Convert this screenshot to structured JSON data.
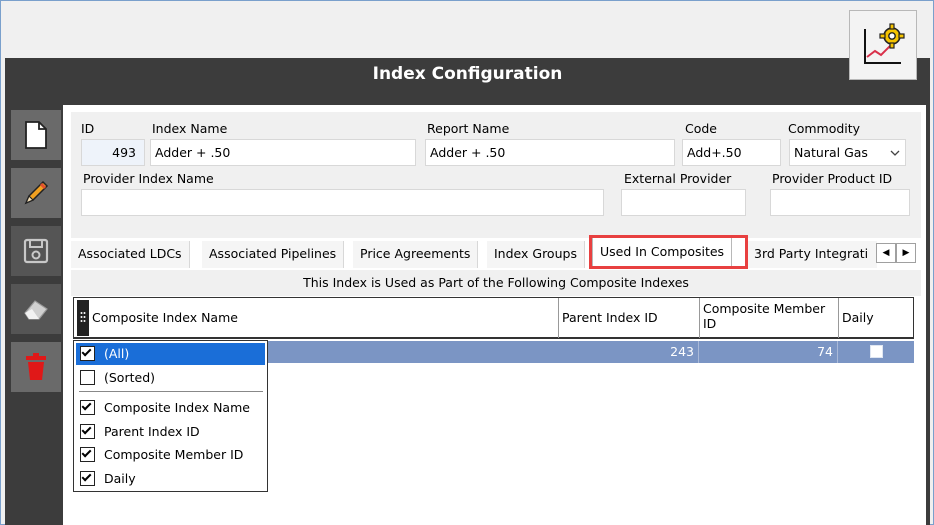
{
  "window": {
    "title": "Index Configuration"
  },
  "toolbar": {
    "buttons": [
      {
        "name": "new-document",
        "icon": "document-icon"
      },
      {
        "name": "edit",
        "icon": "pencil-icon"
      },
      {
        "name": "save",
        "icon": "floppy-disk-icon"
      },
      {
        "name": "clear",
        "icon": "eraser-icon"
      },
      {
        "name": "delete",
        "icon": "trash-icon"
      }
    ]
  },
  "form": {
    "id_label": "ID",
    "id_value": "493",
    "index_name_label": "Index Name",
    "index_name_value": "Adder + .50",
    "report_name_label": "Report Name",
    "report_name_value": "Adder + .50",
    "code_label": "Code",
    "code_value": "Add+.50",
    "commodity_label": "Commodity",
    "commodity_value": "Natural Gas",
    "provider_index_name_label": "Provider Index Name",
    "provider_index_name_value": "",
    "external_provider_label": "External Provider",
    "external_provider_value": "",
    "provider_product_id_label": "Provider Product ID",
    "provider_product_id_value": ""
  },
  "tabs": [
    {
      "label": "Associated LDCs"
    },
    {
      "label": "Associated Pipelines"
    },
    {
      "label": "Price Agreements"
    },
    {
      "label": "Index Groups"
    },
    {
      "label": "Used In Composites"
    },
    {
      "label": "3rd Party Integrati"
    }
  ],
  "grid": {
    "subtitle": "This Index is Used as Part of the Following Composite Indexes",
    "columns": [
      "Composite Index Name",
      "Parent Index ID",
      "Composite Member ID",
      "Daily"
    ],
    "rows": [
      {
        "parent_index_id": "243",
        "composite_member_id": "74",
        "daily": false
      }
    ]
  },
  "column_chooser": {
    "items": [
      {
        "label": "(All)",
        "checked": true,
        "selected": true
      },
      {
        "label": "(Sorted)",
        "checked": false,
        "selected": false
      },
      {
        "label": "Composite Index Name",
        "checked": true
      },
      {
        "label": "Parent Index ID",
        "checked": true
      },
      {
        "label": "Composite Member ID",
        "checked": true
      },
      {
        "label": "Daily",
        "checked": true
      }
    ]
  },
  "colors": {
    "accent_highlight": "#e84040",
    "row_selected": "#7b95c4",
    "title_bar": "#3c3c3c"
  }
}
